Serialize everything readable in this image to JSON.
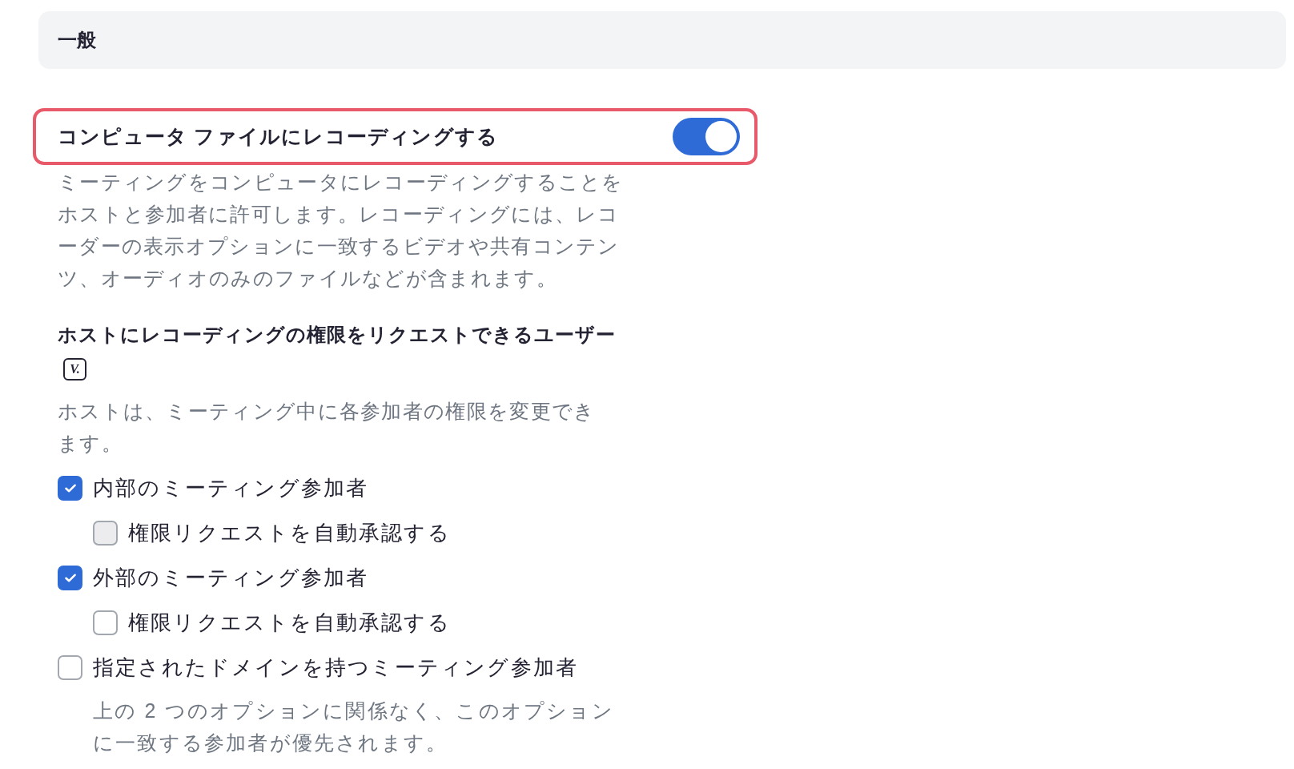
{
  "section": {
    "title": "一般"
  },
  "setting": {
    "title": "コンピュータ ファイルにレコーディングする",
    "on": true,
    "highlighted": true,
    "description": "ミーティングをコンピュータにレコーディングすることをホストと参加者に許可します。レコーディングには、レコーダーの表示オプションに一致するビデオや共有コンテンツ、オーディオのみのファイルなどが含まれます。"
  },
  "permission": {
    "title": "ホストにレコーディングの権限をリクエストできるユーザー",
    "badge": "V.",
    "description": "ホストは、ミーティング中に各参加者の権限を変更できます。",
    "options": [
      {
        "label": "内部のミーティング参加者",
        "checked": true,
        "children": [
          {
            "label": "権限リクエストを自動承認する",
            "checked": false,
            "hovered": true
          }
        ]
      },
      {
        "label": "外部のミーティング参加者",
        "checked": true,
        "children": [
          {
            "label": "権限リクエストを自動承認する",
            "checked": false,
            "hovered": false
          }
        ]
      },
      {
        "label": "指定されたドメインを持つミーティング参加者",
        "checked": false,
        "note": "上の 2 つのオプションに関係なく、このオプションに一致する参加者が優先されます。"
      }
    ]
  }
}
